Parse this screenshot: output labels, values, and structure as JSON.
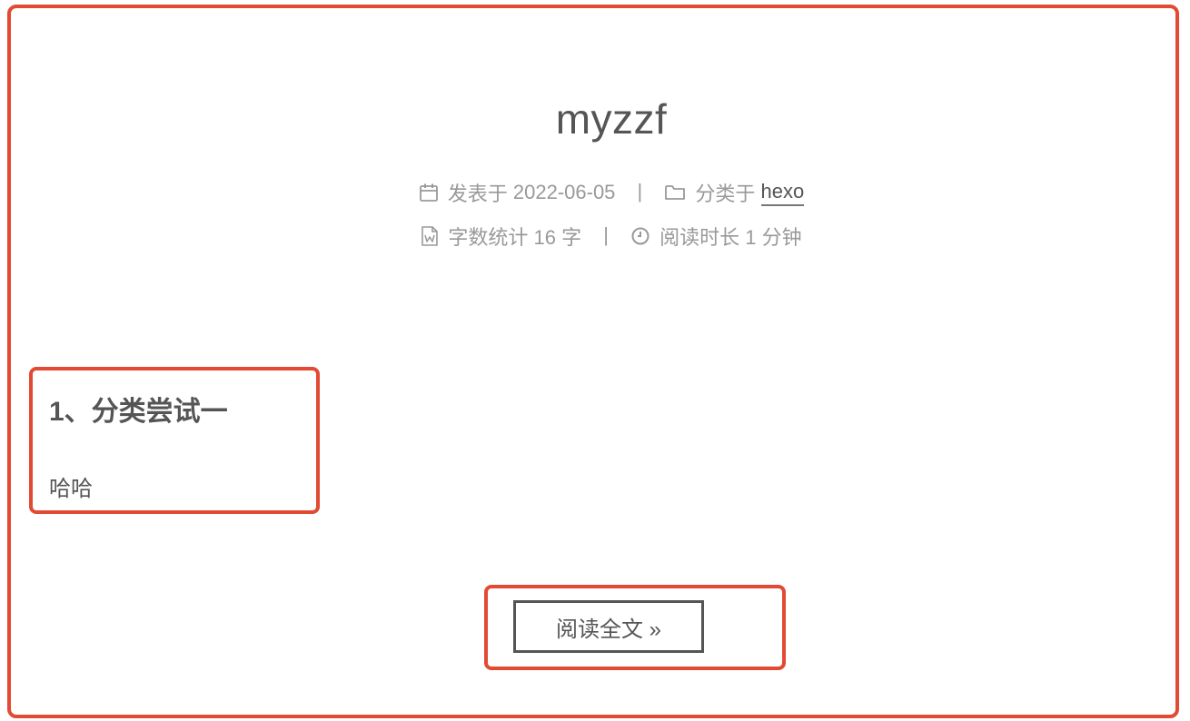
{
  "post": {
    "title": "myzzf",
    "meta": {
      "posted_label": "发表于",
      "posted_date": "2022-06-05",
      "category_label": "分类于",
      "category": "hexo",
      "wordcount_label": "字数统计",
      "wordcount_value": "16 字",
      "readtime_label": "阅读时长",
      "readtime_value": "1 分钟",
      "separator": "|"
    },
    "excerpt": {
      "heading": "1、分类尝试一",
      "text": "哈哈"
    },
    "read_more_label": "阅读全文 »"
  },
  "colors": {
    "highlight_border": "#e24a33",
    "text": "#555555",
    "meta_text": "#999999"
  },
  "icons": {
    "date": "calendar-icon",
    "category": "folder-icon",
    "wordcount": "file-word-icon",
    "readtime": "clock-icon"
  }
}
